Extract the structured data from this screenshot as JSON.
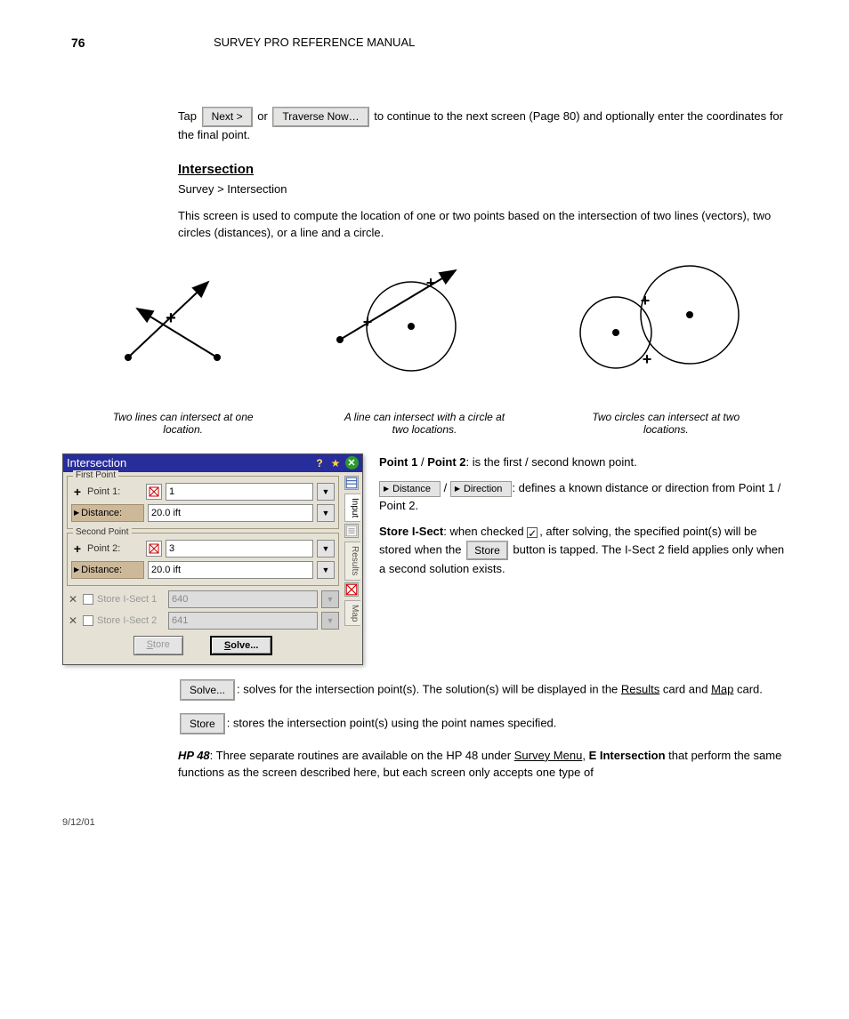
{
  "page_number": "76",
  "header": "SURVEY PRO REFERENCE MANUAL",
  "para1_prefix": "Tap ",
  "btn_next": "Next >",
  "btn_traverse_now": " Traverse Now… ",
  "para1_mid": " or ",
  "para1_end": " to continue to the next screen (Page 80) and optionally enter the coordinates for the final point.",
  "section_title": "Intersection",
  "section_menu": "Survey > Intersection",
  "section_desc": "This screen is used to compute the location of one or two points based on the intersection of two lines (vectors), two circles (distances), or a line and a circle.",
  "captions": {
    "a": "Two lines can intersect at one location.",
    "b": "A line can intersect with a circle at two locations.",
    "c": "Two circles can intersect at two locations."
  },
  "dialog": {
    "title": "Intersection",
    "groups": {
      "first": "First Point",
      "second": "Second Point"
    },
    "labels": {
      "point1": "Point 1:",
      "point2": "Point 2:",
      "distance": "Distance:",
      "store1": "Store I-Sect 1",
      "store2": "Store I-Sect 2"
    },
    "values": {
      "p1": "1",
      "p1_dist": "20.0 ift",
      "p2": "3",
      "p2_dist": "20.0 ift",
      "s1": "640",
      "s2": "641"
    },
    "buttons": {
      "store": "Store",
      "solve": "Solve..."
    },
    "tabs": {
      "input": "Input",
      "results": "Results",
      "map": "Map"
    }
  },
  "right": {
    "p1_a": "Point 1",
    "p1_b": " / ",
    "p1_c": "Point 2",
    "p1_d": ": is the first / second known point.",
    "p2_a": "Distance",
    "p2_b": " / ",
    "p2_c": "Direction",
    "p2_d": ": defines a known distance or direction from Point 1 / Point 2.",
    "p3_a": "Store I-Sect",
    "p3_b": ": when checked ",
    "p3_c": ", after solving, the specified point(s) will be stored when the ",
    "p3_d": " button is tapped.  The I-Sect 2 field applies only when a second solution exists."
  },
  "below": {
    "solve_a": ": solves for the intersection point(s). The solution(s) will be displayed in the ",
    "solve_b": "Results",
    "solve_c": " card and ",
    "solve_d": "Map",
    "solve_e": " card.",
    "store_a": ": stores the intersection point(s) using the point names specified.",
    "hp_a": "HP 48",
    "hp_b": ": Three separate routines are available on the HP 48 under ",
    "hp_c": "Survey Menu",
    "hp_d": ", ",
    "hp_e": "E Intersection",
    "hp_f": " that perform the same functions as the screen described here, but each screen only accepts one type of"
  },
  "footer_date": "9/12/01"
}
